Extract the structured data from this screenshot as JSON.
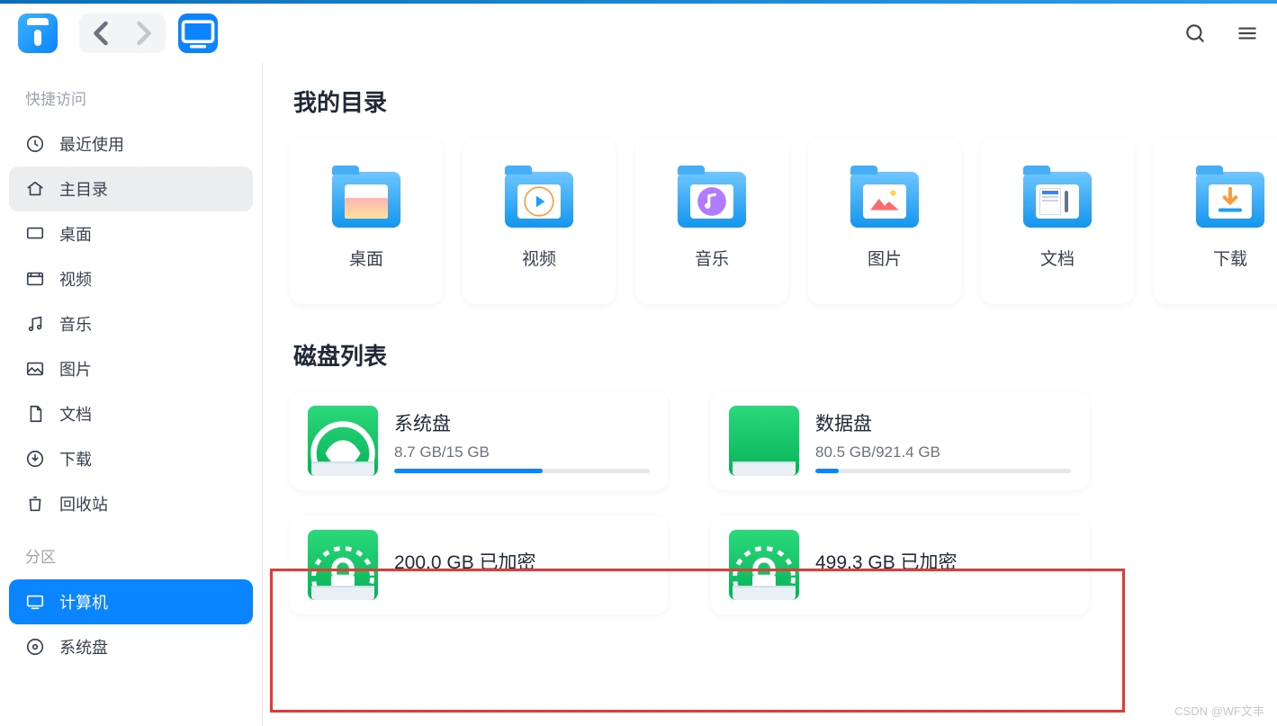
{
  "toolbar": {
    "back": "‹",
    "forward": "›"
  },
  "sidebar": {
    "quick_access_header": "快捷访问",
    "items": [
      {
        "icon": "clock",
        "label": "最近使用"
      },
      {
        "icon": "home",
        "label": "主目录"
      },
      {
        "icon": "desktop",
        "label": "桌面"
      },
      {
        "icon": "video",
        "label": "视频"
      },
      {
        "icon": "music",
        "label": "音乐"
      },
      {
        "icon": "image",
        "label": "图片"
      },
      {
        "icon": "doc",
        "label": "文档"
      },
      {
        "icon": "download",
        "label": "下载"
      },
      {
        "icon": "trash",
        "label": "回收站"
      }
    ],
    "partition_header": "分区",
    "partitions": [
      {
        "icon": "computer",
        "label": "计算机"
      },
      {
        "icon": "disk",
        "label": "系统盘"
      }
    ]
  },
  "main": {
    "my_dir_title": "我的目录",
    "folders": [
      {
        "glyph": "desktop",
        "label": "桌面"
      },
      {
        "glyph": "play",
        "label": "视频"
      },
      {
        "glyph": "note",
        "label": "音乐"
      },
      {
        "glyph": "mount",
        "label": "图片"
      },
      {
        "glyph": "docf",
        "label": "文档"
      },
      {
        "glyph": "down",
        "label": "下载"
      }
    ],
    "disk_title": "磁盘列表",
    "disks": [
      {
        "name": "系统盘",
        "usage": "8.7 GB/15 GB",
        "fill": 58,
        "glyph": "deepin"
      },
      {
        "name": "数据盘",
        "usage": "80.5 GB/921.4 GB",
        "fill": 9,
        "glyph": "blank"
      },
      {
        "name": "200.0 GB 已加密",
        "usage": "",
        "fill": -1,
        "glyph": "lock"
      },
      {
        "name": "499.3 GB 已加密",
        "usage": "",
        "fill": -1,
        "glyph": "lock"
      }
    ]
  },
  "watermark": "CSDN @WF文丰"
}
